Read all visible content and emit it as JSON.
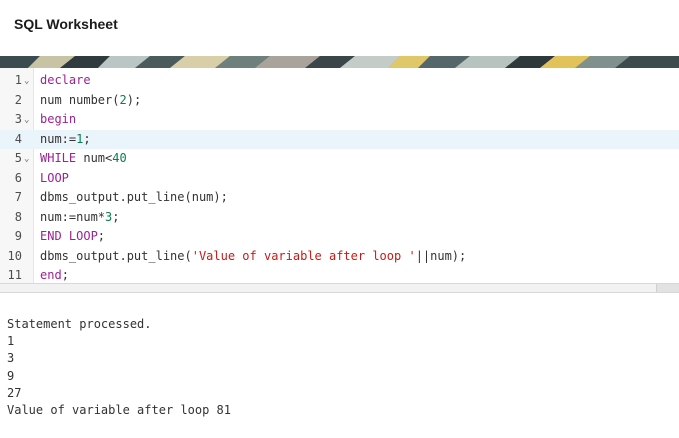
{
  "header": {
    "title": "SQL Worksheet"
  },
  "editor": {
    "active_line": 4,
    "lines": [
      {
        "n": "1",
        "fold": true
      },
      {
        "n": "2",
        "fold": false
      },
      {
        "n": "3",
        "fold": true
      },
      {
        "n": "4",
        "fold": false
      },
      {
        "n": "5",
        "fold": true
      },
      {
        "n": "6",
        "fold": false
      },
      {
        "n": "7",
        "fold": false
      },
      {
        "n": "8",
        "fold": false
      },
      {
        "n": "9",
        "fold": false
      },
      {
        "n": "10",
        "fold": false
      },
      {
        "n": "11",
        "fold": false
      }
    ],
    "code": {
      "l1": "declare",
      "l2_a": "num number(",
      "l2_b": "2",
      "l2_c": ");",
      "l3": "begin",
      "l4_a": "num:=",
      "l4_b": "1",
      "l4_c": ";",
      "l5_a": "WHILE",
      "l5_b": " num<",
      "l5_c": "40",
      "l6": "LOOP",
      "l7": "dbms_output.put_line(num);",
      "l8_a": "num:=num*",
      "l8_b": "3",
      "l8_c": ";",
      "l9_a": "END LOOP",
      "l9_b": ";",
      "l10_a": "dbms_output.put_line(",
      "l10_b": "'Value of variable after loop '",
      "l10_c": "||num);",
      "l11_a": "end",
      "l11_b": ";"
    }
  },
  "output": {
    "lines": [
      "Statement processed.",
      "1",
      "3",
      "9",
      "27",
      "Value of variable after loop 81"
    ]
  },
  "colors": {
    "keyword": "#9b2393",
    "number": "#0a7d4f",
    "string": "#c41a16",
    "active_line": "#eaf4fb"
  }
}
